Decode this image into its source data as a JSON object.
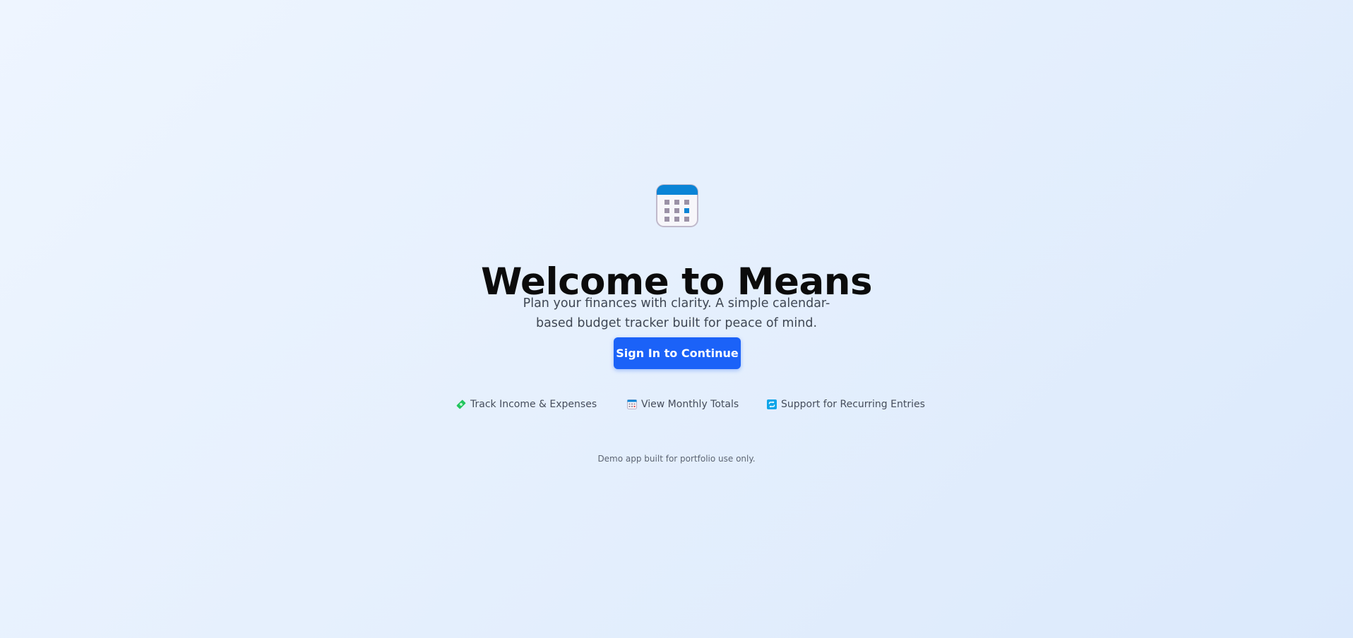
{
  "hero": {
    "icon": "calendar-icon",
    "title": "Welcome to Means",
    "subtitle": "Plan your finances with clarity. A simple calendar-based budget tracker built for peace of mind.",
    "button_label": "Sign In to Continue"
  },
  "features": [
    {
      "icon": "money-icon",
      "label": "Track Income & Expenses"
    },
    {
      "icon": "calendar-icon",
      "label": "View Monthly Totals"
    },
    {
      "icon": "repeat-icon",
      "label": "Support for Recurring Entries"
    }
  ],
  "footer": {
    "note": "Demo app built for portfolio use only."
  },
  "colors": {
    "accent": "#1b62f8",
    "calendar_header": "#0a84d6",
    "feature_money": "#22c55e",
    "feature_repeat": "#0ea5e9"
  }
}
